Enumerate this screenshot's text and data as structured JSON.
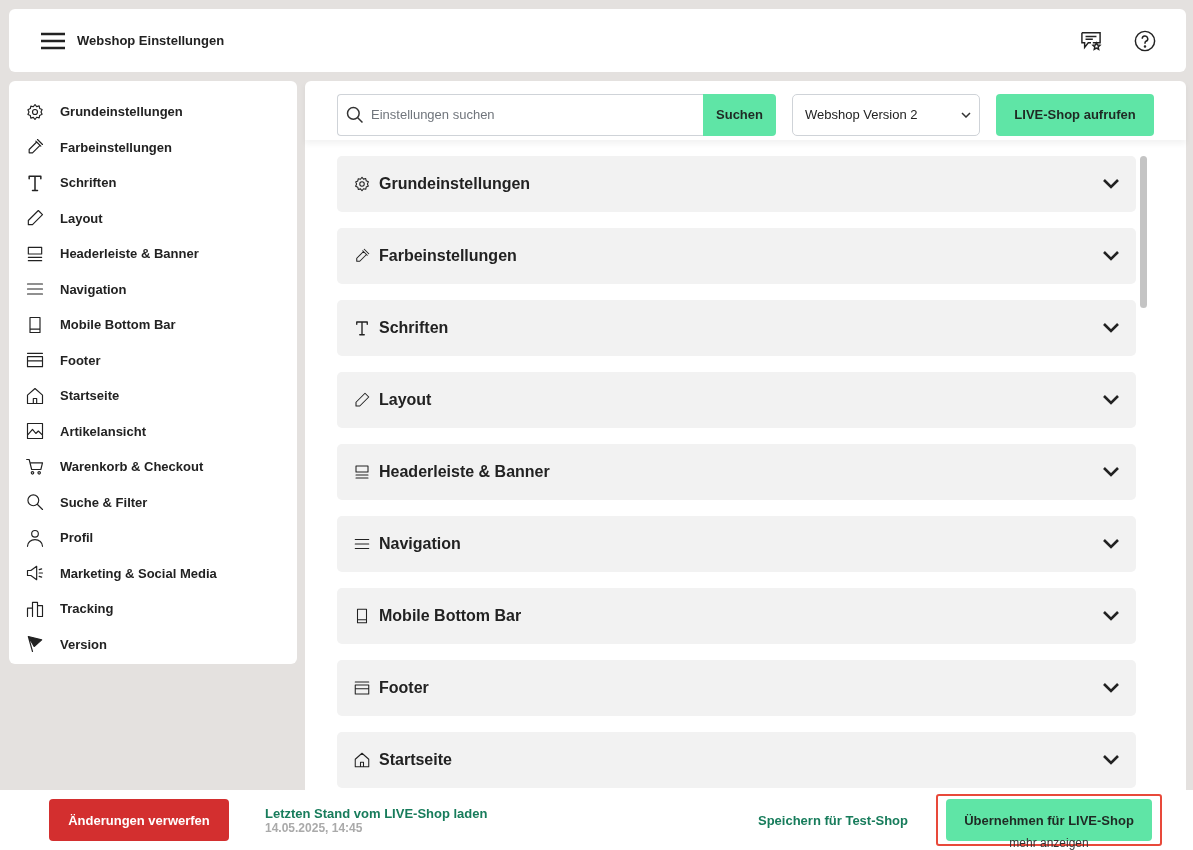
{
  "header": {
    "title": "Webshop Einstellungen"
  },
  "sidebar": {
    "items": [
      {
        "label": "Grundeinstellungen"
      },
      {
        "label": "Farbeinstellungen"
      },
      {
        "label": "Schriften"
      },
      {
        "label": "Layout"
      },
      {
        "label": "Headerleiste & Banner"
      },
      {
        "label": "Navigation"
      },
      {
        "label": "Mobile Bottom Bar"
      },
      {
        "label": "Footer"
      },
      {
        "label": "Startseite"
      },
      {
        "label": "Artikelansicht"
      },
      {
        "label": "Warenkorb & Checkout"
      },
      {
        "label": "Suche & Filter"
      },
      {
        "label": "Profil"
      },
      {
        "label": "Marketing & Social Media"
      },
      {
        "label": "Tracking"
      },
      {
        "label": "Version"
      }
    ]
  },
  "toolbar": {
    "search": {
      "placeholder": "Einstellungen suchen"
    },
    "search_button": "Suchen",
    "version_select": "Webshop Version 2",
    "live_button": "LIVE-Shop aufrufen"
  },
  "sections": [
    {
      "label": "Grundeinstellungen",
      "expanded": false
    },
    {
      "label": "Farbeinstellungen",
      "expanded": false
    },
    {
      "label": "Schriften",
      "expanded": false
    },
    {
      "label": "Layout",
      "expanded": false
    },
    {
      "label": "Headerleiste & Banner",
      "expanded": false
    },
    {
      "label": "Navigation",
      "expanded": false
    },
    {
      "label": "Mobile Bottom Bar",
      "expanded": false
    },
    {
      "label": "Footer",
      "expanded": false
    },
    {
      "label": "Startseite",
      "expanded": false
    }
  ],
  "footer": {
    "discard_button": "Änderungen verwerfen",
    "load_link": "Letzten Stand vom LIVE-Shop laden",
    "load_date": "14.05.2025, 14:45",
    "save_test_button": "Speichern für Test-Shop",
    "apply_live_button": "Übernehmen für LIVE-Shop",
    "apply_live_highlighted": true,
    "more_link": "mehr anzeigen"
  }
}
